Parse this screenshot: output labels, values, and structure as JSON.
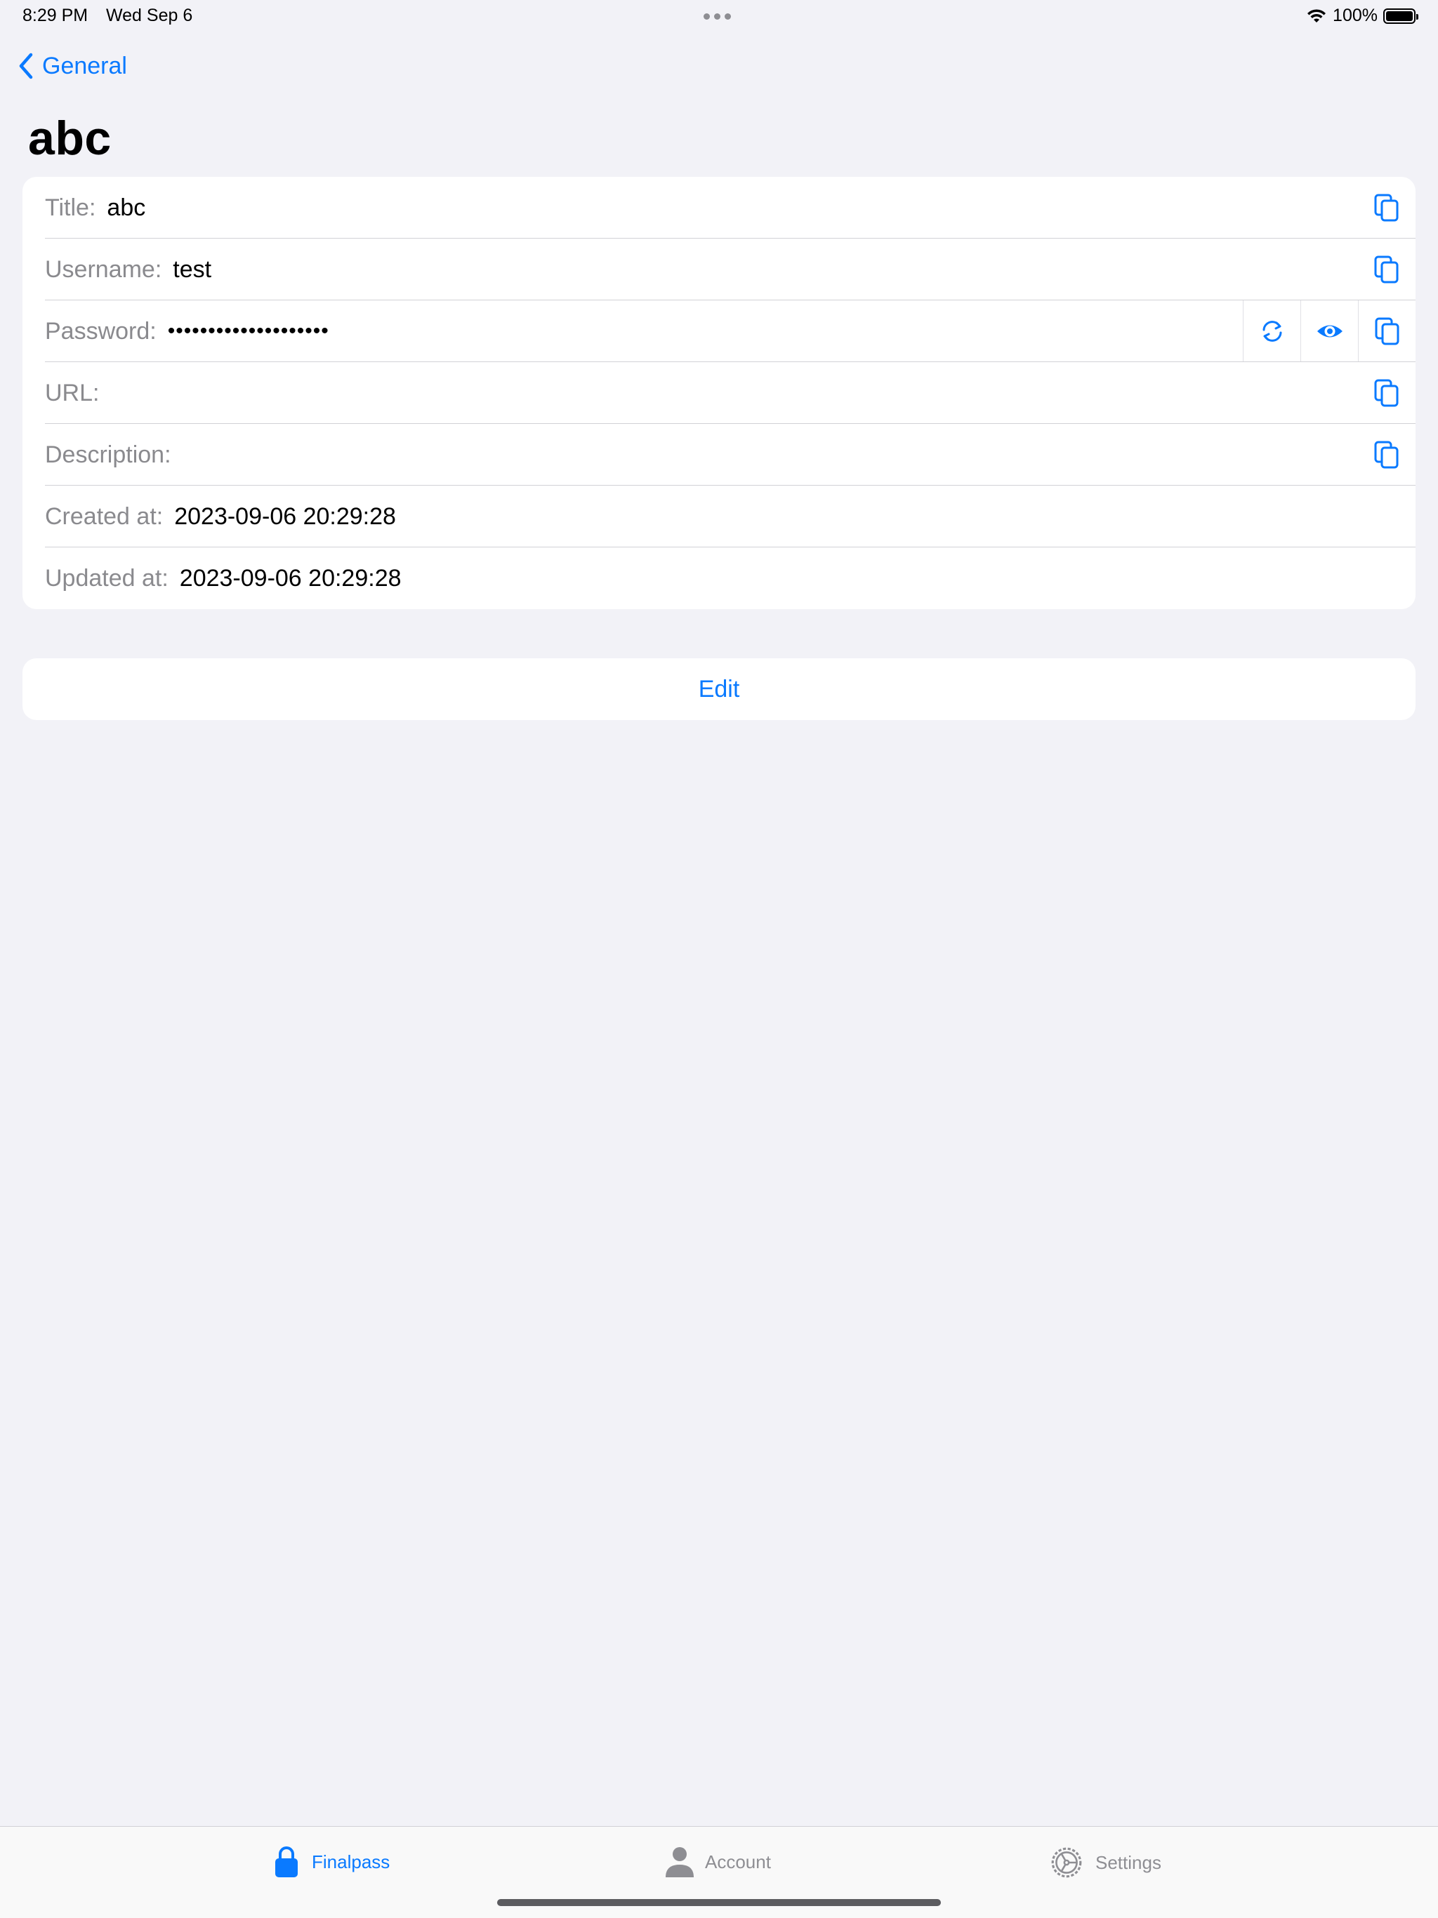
{
  "status_bar": {
    "time": "8:29 PM",
    "date": "Wed Sep 6",
    "battery": "100%"
  },
  "nav": {
    "back_label": "General",
    "title": "abc"
  },
  "details": {
    "title": {
      "label": "Title:",
      "value": "abc"
    },
    "username": {
      "label": "Username:",
      "value": "test"
    },
    "password": {
      "label": "Password:",
      "value": "••••••••••••••••••••"
    },
    "url": {
      "label": "URL:",
      "value": ""
    },
    "description": {
      "label": "Description:",
      "value": ""
    },
    "created": {
      "label": "Created at:",
      "value": "2023-09-06 20:29:28"
    },
    "updated": {
      "label": "Updated at:",
      "value": "2023-09-06 20:29:28"
    }
  },
  "actions": {
    "edit_label": "Edit"
  },
  "tabs": [
    {
      "label": "Finalpass",
      "icon": "lock-icon",
      "active": true
    },
    {
      "label": "Account",
      "icon": "person-icon",
      "active": false
    },
    {
      "label": "Settings",
      "icon": "gear-icon",
      "active": false
    }
  ],
  "colors": {
    "accent": "#0a7aff",
    "background": "#f2f2f7",
    "secondary_text": "#8a8a8e"
  }
}
